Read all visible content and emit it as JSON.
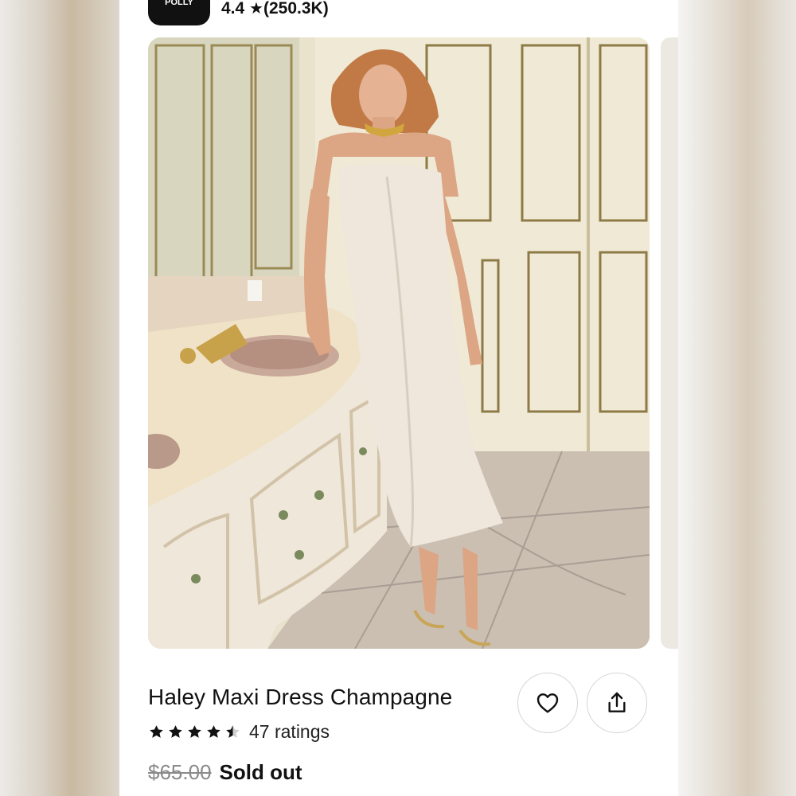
{
  "store": {
    "logo_text": "POLLY",
    "rating": "4.4",
    "rating_star": "★",
    "review_count": "(250.3K)"
  },
  "product": {
    "title": "Haley Maxi Dress Champagne",
    "rating_value": 4.5,
    "rating_count_label": "47 ratings",
    "original_price": "$65.00",
    "status": "Sold out"
  },
  "icons": {
    "favorite": "heart-icon",
    "share": "share-icon",
    "star": "star-icon"
  },
  "colors": {
    "background": "#ffffff",
    "text": "#111111",
    "strike_price": "#8a8a8a",
    "logo_bg": "#111111"
  }
}
